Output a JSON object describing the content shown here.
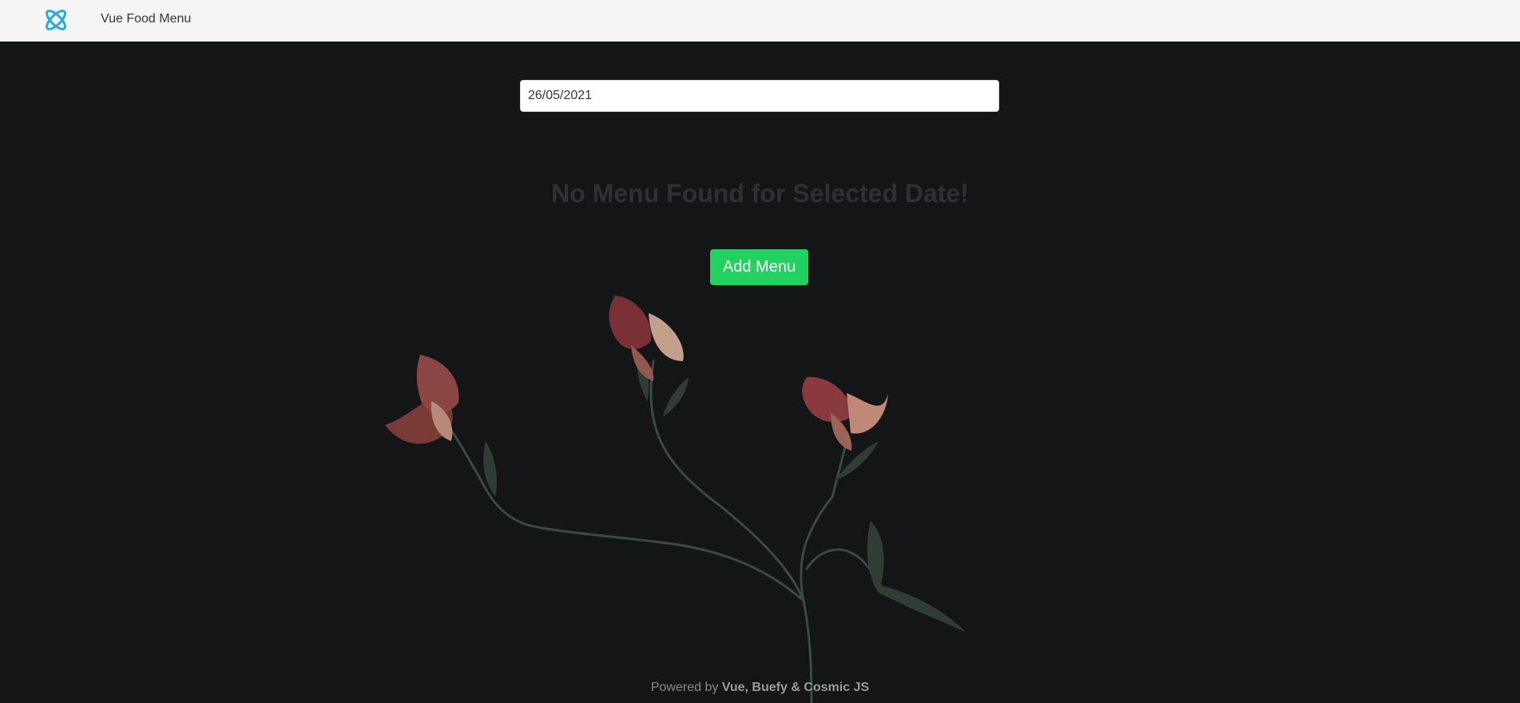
{
  "navbar": {
    "logo_icon": "cosmic-atom-icon",
    "logo_color": "#29abe2",
    "brand": "Vue Food Menu"
  },
  "main": {
    "date_value": "26/05/2021",
    "empty_message": "No Menu Found for Selected Date!",
    "add_button_label": "Add Menu",
    "add_button_color": "#23d160"
  },
  "footer": {
    "prefix": "Powered by ",
    "credits": "Vue, Buefy & Cosmic JS"
  }
}
